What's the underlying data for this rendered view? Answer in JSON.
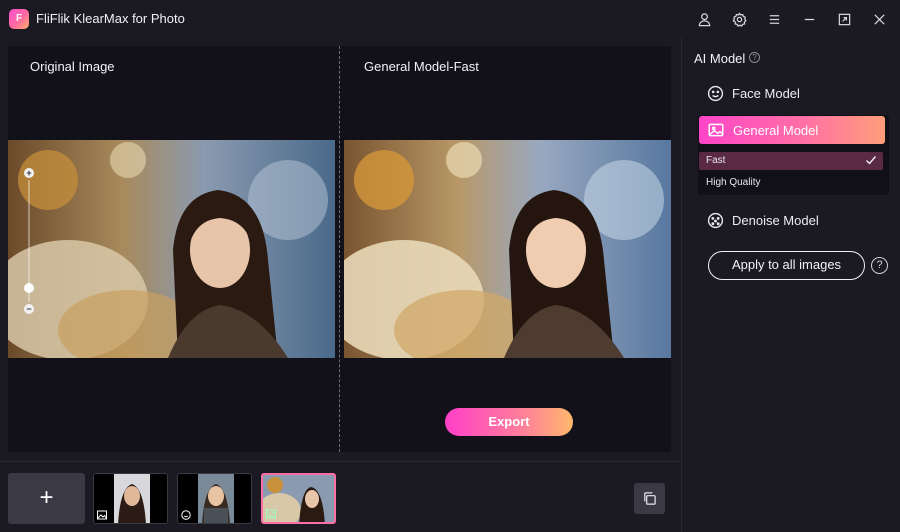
{
  "app": {
    "title": "FliFlik KlearMax for Photo",
    "logo_text": "F"
  },
  "titlebar": {
    "icons": [
      "user-icon",
      "gear-icon",
      "menu-icon",
      "minimize-icon",
      "maximize-icon",
      "close-icon"
    ]
  },
  "preview": {
    "left_label": "Original Image",
    "right_label": "General Model-Fast",
    "zoom_in": "+",
    "zoom_out": "−",
    "export_label": "Export"
  },
  "side": {
    "title": "AI Model",
    "help": "?",
    "face_model": "Face Model",
    "general_model": "General Model",
    "options": [
      {
        "label": "Fast",
        "selected": true
      },
      {
        "label": "High Quality",
        "selected": false
      }
    ],
    "denoise_model": "Denoise Model",
    "apply_label": "Apply to all images",
    "help_big": "?"
  },
  "bottom": {
    "add_label": "+",
    "thumbnails": [
      {
        "badge": "image-icon",
        "active": false
      },
      {
        "badge": "face-icon",
        "active": false
      },
      {
        "badge": "denoise-icon",
        "active": true
      }
    ]
  },
  "colors": {
    "accent_gradient_start": "#ff44c9",
    "accent_gradient_end": "#ffb86c",
    "background": "#1b1a22",
    "preview_bg": "#121119"
  }
}
